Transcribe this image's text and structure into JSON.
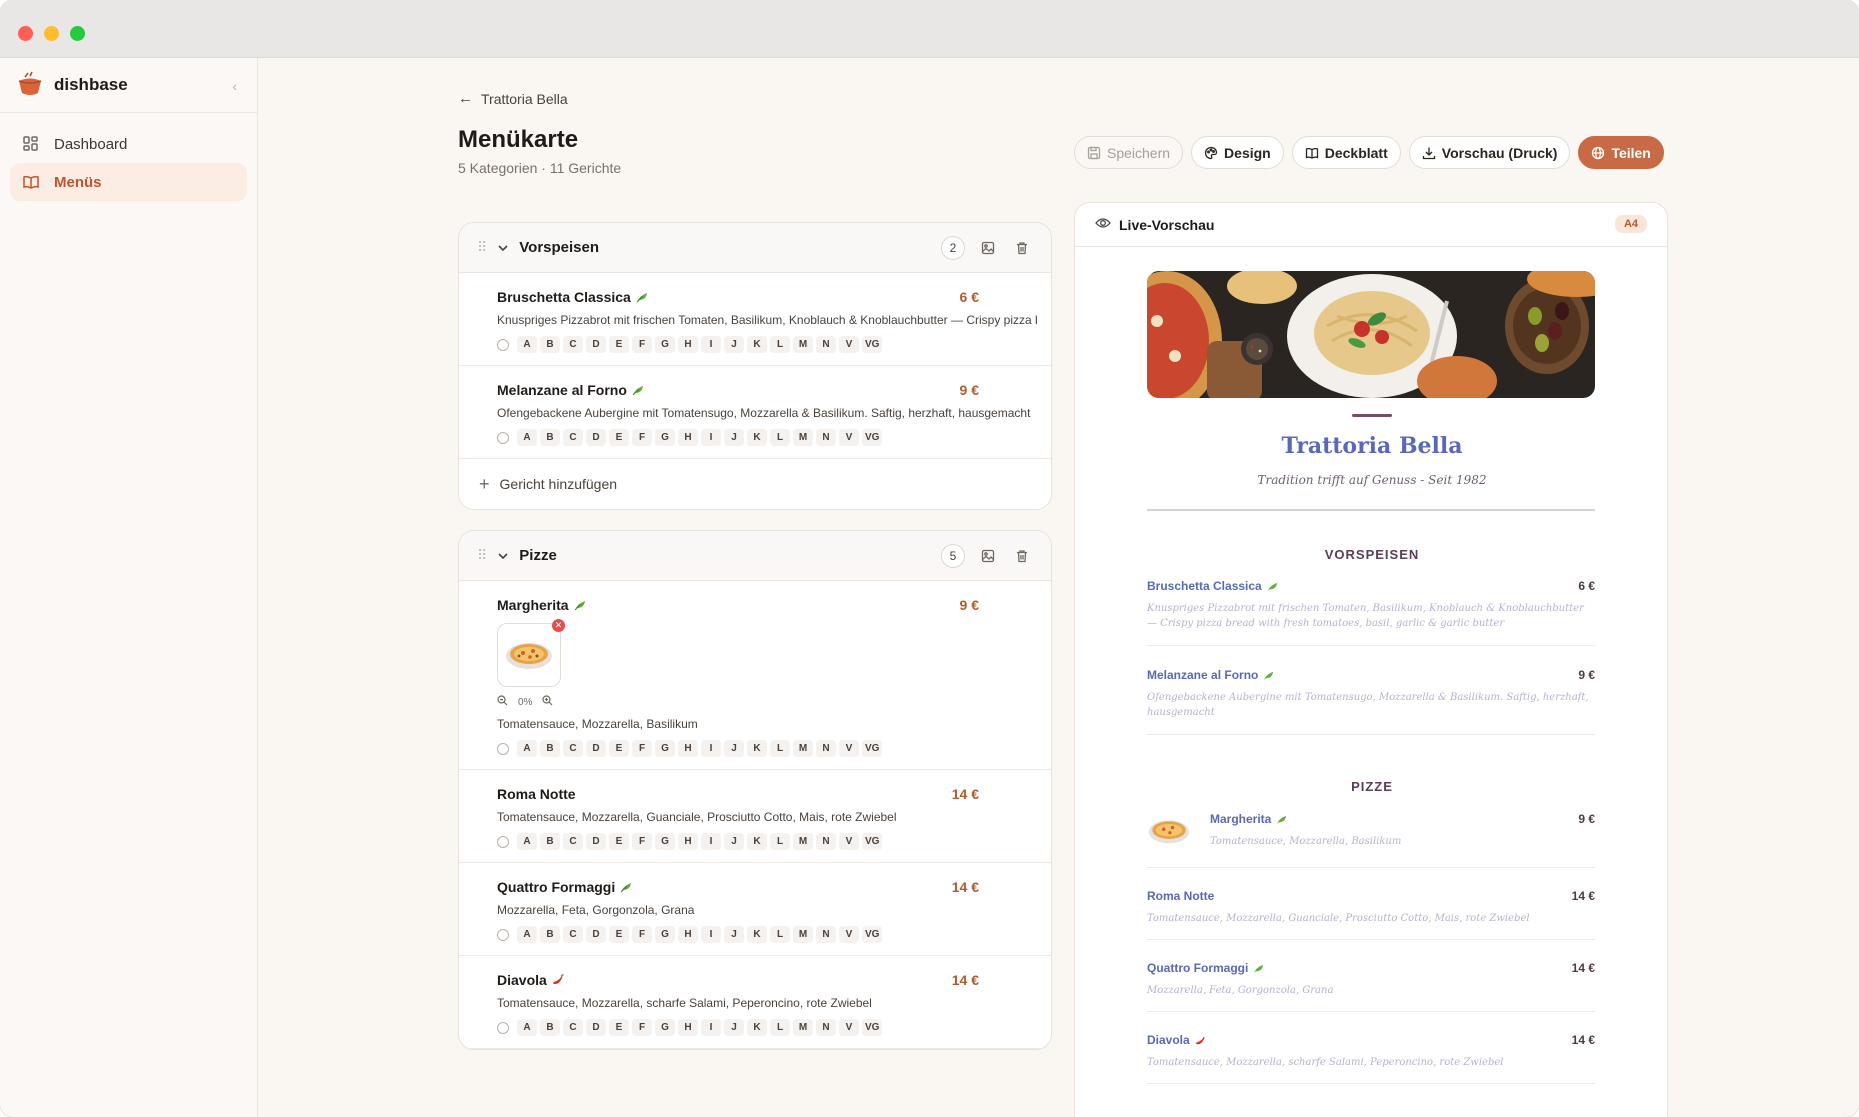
{
  "app": {
    "name": "dishbase"
  },
  "sidebar": {
    "items": [
      {
        "label": "Dashboard",
        "icon": "grid-icon"
      },
      {
        "label": "Menüs",
        "icon": "book-open-icon",
        "active": true
      }
    ]
  },
  "header": {
    "breadcrumb": "Trattoria Bella",
    "title": "Menükarte",
    "subtitle": "5 Kategorien · 11 Gerichte"
  },
  "toolbar": {
    "save": "Speichern",
    "design": "Design",
    "cover": "Deckblatt",
    "print_preview": "Vorschau (Druck)",
    "share": "Teilen"
  },
  "allergen_codes": [
    "A",
    "B",
    "C",
    "D",
    "E",
    "F",
    "G",
    "H",
    "I",
    "J",
    "K",
    "L",
    "M",
    "N",
    "V",
    "VG"
  ],
  "editor": {
    "add_dish_label": "Gericht hinzufügen",
    "categories": [
      {
        "title": "Vorspeisen",
        "count": "2",
        "dishes": [
          {
            "name": "Bruschetta Classica",
            "price": "6 €",
            "desc": "Knuspriges Pizzabrot mit frischen Tomaten, Basilikum, Knoblauch & Knoblauchbutter — Crispy pizza bread with fresh tomatoes",
            "tag": "leaf"
          },
          {
            "name": "Melanzane al Forno",
            "price": "9 €",
            "desc": "Ofengebackene Aubergine mit Tomatensugo, Mozzarella & Basilikum. Saftig, herzhaft, hausgemacht",
            "tag": "leaf"
          }
        ]
      },
      {
        "title": "Pizze",
        "count": "5",
        "dishes": [
          {
            "name": "Margherita",
            "price": "9 €",
            "desc": "Tomatensauce, Mozzarella, Basilikum",
            "tag": "leaf",
            "zoom": "0%"
          },
          {
            "name": "Roma Notte",
            "price": "14 €",
            "desc": "Tomatensauce, Mozzarella, Guanciale, Prosciutto Cotto, Mais, rote Zwiebel",
            "tag": ""
          },
          {
            "name": "Quattro Formaggi",
            "price": "14 €",
            "desc": "Mozzarella, Feta, Gorgonzola, Grana",
            "tag": "leaf"
          },
          {
            "name": "Diavola",
            "price": "14 €",
            "desc": "Tomatensauce, Mozzarella, scharfe Salami, Peperoncino, rote Zwiebel",
            "tag": "chili"
          }
        ]
      }
    ]
  },
  "preview": {
    "label": "Live-Vorschau",
    "format": "A4",
    "restaurant": "Trattoria Bella",
    "tagline": "Tradition trifft auf Genuss - Seit 1982",
    "sections": [
      {
        "title": "VORSPEISEN",
        "items": [
          {
            "name": "Bruschetta Classica",
            "price": "6 €",
            "desc": "Knuspriges Pizzabrot mit frischen Tomaten, Basilikum, Knoblauch & Knoblauchbutter — Crispy pizza bread with fresh tomatoes, basil, garlic & garlic butter"
          },
          {
            "name": "Melanzane al Forno",
            "price": "9 €",
            "desc": "Ofengebackene Aubergine mit Tomatensugo, Mozzarella & Basilikum. Saftig, herzhaft, hausgemacht"
          }
        ]
      },
      {
        "title": "PIZZE",
        "items": [
          {
            "name": "Margherita",
            "price": "9 €",
            "desc": "Tomatensauce, Mozzarella, Basilikum"
          },
          {
            "name": "Roma Notte",
            "price": "14 €",
            "desc": "Tomatensauce, Mozzarella, Guanciale, Prosciutto Cotto, Mais, rote Zwiebel"
          },
          {
            "name": "Quattro Formaggi",
            "price": "14 €",
            "desc": "Mozzarella, Feta, Gorgonzola, Grana"
          },
          {
            "name": "Diavola",
            "price": "14 €",
            "desc": "Tomatensauce, Mozzarella, scharfe Salami, Peperoncino, rote Zwiebel"
          }
        ]
      }
    ]
  },
  "colors": {
    "accent": "#c86a45",
    "price": "#b15b2e",
    "preview_name": "#5a68b8",
    "preview_heading": "#5a3d56"
  }
}
